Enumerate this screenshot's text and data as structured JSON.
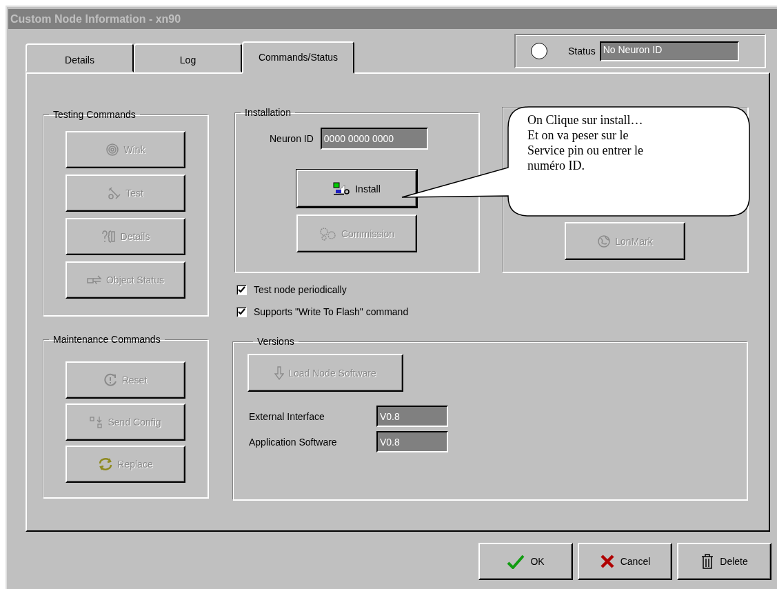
{
  "window": {
    "title": "Custom Node Information - xn90"
  },
  "tabs": [
    {
      "label": "Details",
      "selected": false
    },
    {
      "label": "Log",
      "selected": false
    },
    {
      "label": "Commands/Status",
      "selected": true
    }
  ],
  "status": {
    "label": "Status",
    "value": "No Neuron ID",
    "indicator_on": false
  },
  "testing_commands": {
    "title": "Testing Commands",
    "buttons": [
      {
        "label": "Wink",
        "disabled": true
      },
      {
        "label": "Test",
        "disabled": true
      },
      {
        "label": "Details",
        "disabled": true
      },
      {
        "label": "Object Status",
        "disabled": true
      }
    ]
  },
  "installation": {
    "title": "Installation",
    "neuron_id": {
      "label": "Neuron ID",
      "value": "0000 0000 0000"
    },
    "buttons": [
      {
        "label": "Install",
        "disabled": false
      },
      {
        "label": "Commission",
        "disabled": true
      }
    ]
  },
  "lonmark_group": {
    "buttons": [
      {
        "label": "LonMark",
        "disabled": true
      }
    ]
  },
  "options": [
    {
      "label": "Test node periodically",
      "checked": true
    },
    {
      "label": "Supports \"Write To Flash\" command",
      "checked": true
    }
  ],
  "maintenance_commands": {
    "title": "Maintenance Commands",
    "buttons": [
      {
        "label": "Reset",
        "disabled": true
      },
      {
        "label": "Send Config",
        "disabled": true
      },
      {
        "label": "Replace",
        "disabled": true
      }
    ]
  },
  "versions": {
    "title": "Versions",
    "buttons": [
      {
        "label": "Load Node Software",
        "disabled": true
      }
    ],
    "fields": [
      {
        "label": "External Interface",
        "value": "V0.8"
      },
      {
        "label": "Application Software",
        "value": "V0.8"
      }
    ]
  },
  "dialog_buttons": [
    {
      "label": "OK",
      "disabled": false
    },
    {
      "label": "Cancel",
      "disabled": false
    },
    {
      "label": "Delete",
      "disabled": false
    }
  ],
  "callout": {
    "text": "On Clique sur install…\nEt on va peser sur le\nService pin ou entrer le\nnuméro ID."
  }
}
